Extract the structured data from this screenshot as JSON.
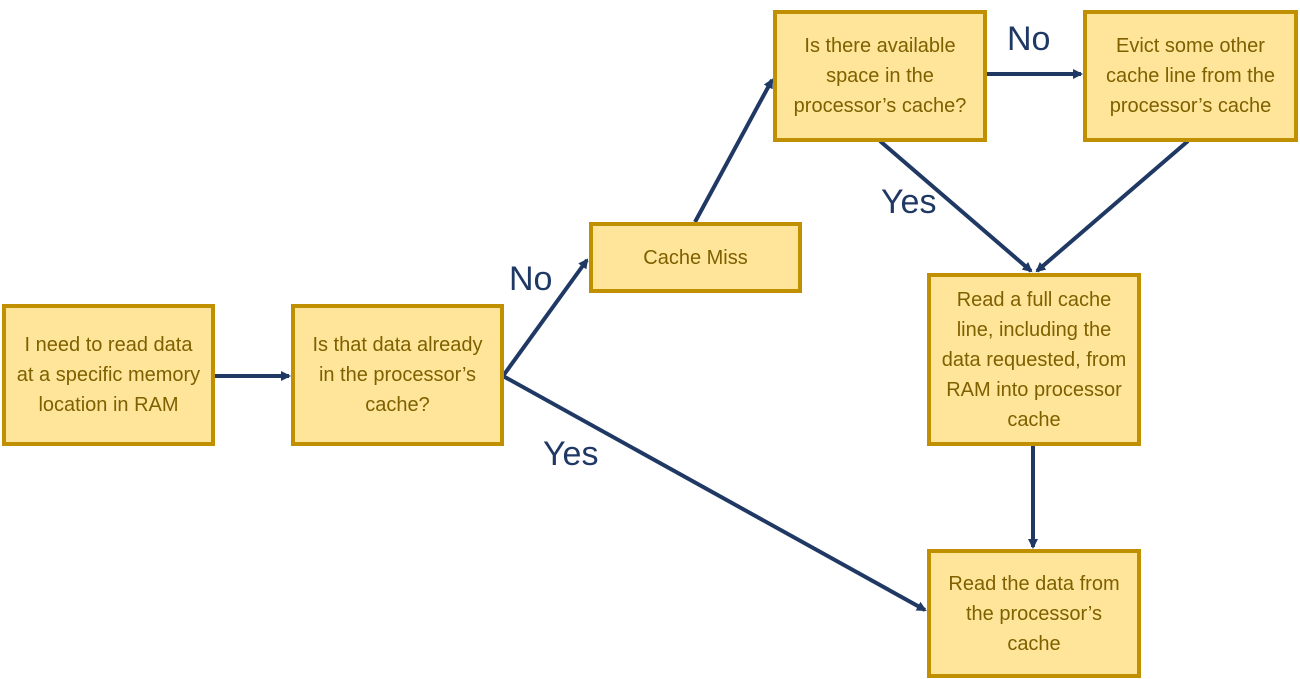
{
  "colors": {
    "box_fill": "#FEE599",
    "box_border": "#C09000",
    "box_text": "#7F6000",
    "arrow": "#1F3864"
  },
  "nodes": {
    "start": "I need to read data at a specific memory location in RAM",
    "in_cache": "Is that data already in the processor’s cache?",
    "miss": "Cache Miss",
    "space": "Is there available space in the processor’s cache?",
    "evict": "Evict some other cache line from the processor’s cache",
    "read_line": "Read a full cache line, including the data requested, from RAM into processor cache",
    "read_data": "Read the data from the processor’s cache"
  },
  "edge_labels": {
    "no_miss": "No",
    "yes_hit": "Yes",
    "no_space": "No",
    "yes_space": "Yes"
  }
}
